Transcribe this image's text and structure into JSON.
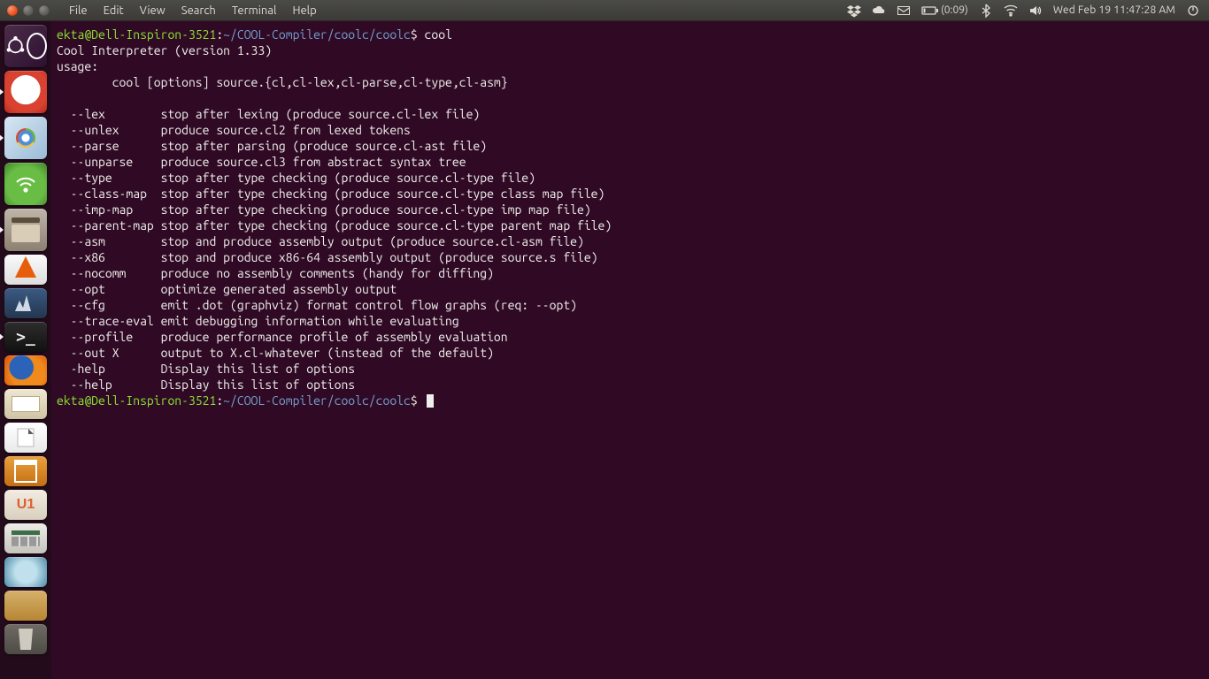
{
  "menubar": {
    "menus": [
      "File",
      "Edit",
      "View",
      "Search",
      "Terminal",
      "Help"
    ],
    "battery": "(0:09)",
    "clock": "Wed Feb 19  11:47:28 AM"
  },
  "launcher": [
    {
      "name": "dash",
      "label": "Dash Home"
    },
    {
      "name": "evince",
      "label": "Document Viewer",
      "running": true
    },
    {
      "name": "chromium",
      "label": "Chromium",
      "running": true
    },
    {
      "name": "wifi",
      "label": "Network"
    },
    {
      "name": "files",
      "label": "Files",
      "running": true
    },
    {
      "name": "vlc",
      "label": "VLC"
    },
    {
      "name": "amarok",
      "label": "Amarok"
    },
    {
      "name": "term",
      "label": "Terminal",
      "running": true
    },
    {
      "name": "firefox",
      "label": "Firefox"
    },
    {
      "name": "gedit",
      "label": "Text Editor"
    },
    {
      "name": "libre",
      "label": "LibreOffice"
    },
    {
      "name": "softcenter",
      "label": "Software Center"
    },
    {
      "name": "ubone",
      "label": "Ubuntu One"
    },
    {
      "name": "calc",
      "label": "Calculator"
    },
    {
      "name": "disk",
      "label": "Disk Utility"
    },
    {
      "name": "folder",
      "label": "Home Folder"
    },
    {
      "name": "trash",
      "label": "Trash"
    }
  ],
  "terminal": {
    "prompt_user": "ekta@Dell-Inspiron-3521",
    "prompt_sep1": ":",
    "prompt_path": "~/COOL-Compiler/coolc/coolc",
    "prompt_sep2": "$ ",
    "command": "cool",
    "header1": "Cool Interpreter (version 1.33)",
    "header2": "usage:",
    "usage_line": "        cool [options] source.{cl,cl-lex,cl-parse,cl-type,cl-asm}",
    "options": [
      {
        "flag": "  --lex        ",
        "desc": "stop after lexing (produce source.cl-lex file)"
      },
      {
        "flag": "  --unlex      ",
        "desc": "produce source.cl2 from lexed tokens"
      },
      {
        "flag": "  --parse      ",
        "desc": "stop after parsing (produce source.cl-ast file)"
      },
      {
        "flag": "  --unparse    ",
        "desc": "produce source.cl3 from abstract syntax tree"
      },
      {
        "flag": "  --type       ",
        "desc": "stop after type checking (produce source.cl-type file)"
      },
      {
        "flag": "  --class-map  ",
        "desc": "stop after type checking (produce source.cl-type class map file)"
      },
      {
        "flag": "  --imp-map    ",
        "desc": "stop after type checking (produce source.cl-type imp map file)"
      },
      {
        "flag": "  --parent-map ",
        "desc": "stop after type checking (produce source.cl-type parent map file)"
      },
      {
        "flag": "  --asm        ",
        "desc": "stop and produce assembly output (produce source.cl-asm file)"
      },
      {
        "flag": "  --x86        ",
        "desc": "stop and produce x86-64 assembly output (produce source.s file)"
      },
      {
        "flag": "  --nocomm     ",
        "desc": "produce no assembly comments (handy for diffing)"
      },
      {
        "flag": "  --opt        ",
        "desc": "optimize generated assembly output"
      },
      {
        "flag": "  --cfg        ",
        "desc": "emit .dot (graphviz) format control flow graphs (req: --opt)"
      },
      {
        "flag": "  --trace-eval ",
        "desc": "emit debugging information while evaluating"
      },
      {
        "flag": "  --profile    ",
        "desc": "produce performance profile of assembly evaluation"
      },
      {
        "flag": "  --out X      ",
        "desc": "output to X.cl-whatever (instead of the default)"
      },
      {
        "flag": "  -help        ",
        "desc": "Display this list of options"
      },
      {
        "flag": "  --help       ",
        "desc": "Display this list of options"
      }
    ]
  }
}
